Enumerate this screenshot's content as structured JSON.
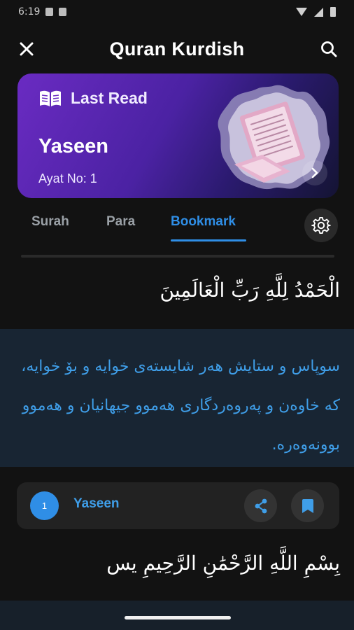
{
  "status_bar": {
    "time": "6:19"
  },
  "app_bar": {
    "title": "Quran Kurdish"
  },
  "last_read_card": {
    "label": "Last Read",
    "surah": "Yaseen",
    "ayat": "Ayat No: 1"
  },
  "tabs": [
    {
      "label": "Surah",
      "active": false
    },
    {
      "label": "Para",
      "active": false
    },
    {
      "label": "Bookmark",
      "active": true
    }
  ],
  "verses": [
    {
      "arabic": "الْحَمْدُ لِلَّهِ رَبِّ الْعَالَمِينَ",
      "translation": "سوپاس و ستایش هەر شایستەی خوایە و بۆ خوایە، کە خاوەن و پەروەردگاری هەموو جیهانیان و هەموو بوونەوەرە."
    }
  ],
  "bookmark_item": {
    "number": "1",
    "surah": "Yaseen",
    "arabic": "بِسْمِ اللَّهِ الرَّحْمَٰنِ الرَّحِيمِ يس"
  },
  "colors": {
    "accent": "#2f8ee6",
    "background": "#121212",
    "translation_bg": "#182533"
  },
  "icons": {
    "close": "close-icon",
    "search": "search-icon",
    "book": "book-icon",
    "settings": "gear-icon",
    "share": "share-icon",
    "bookmark": "bookmark-icon"
  }
}
